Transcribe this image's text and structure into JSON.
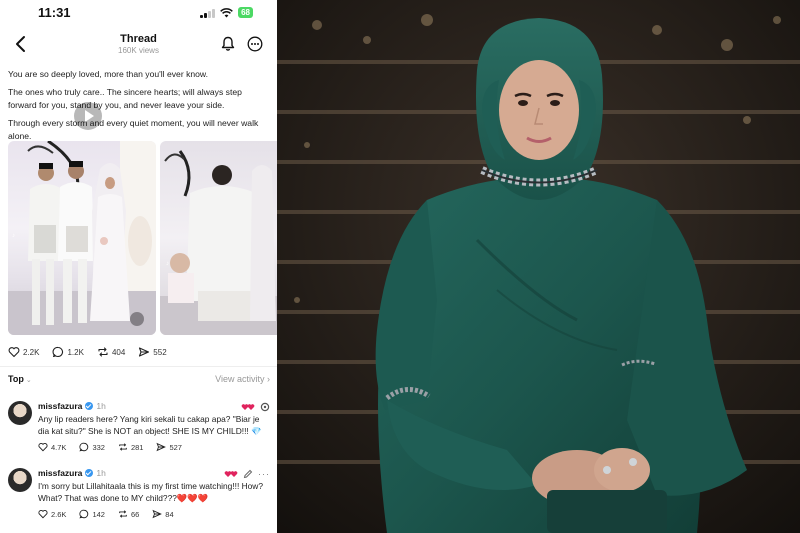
{
  "status_bar": {
    "time": "11:31",
    "battery": "68"
  },
  "thread_header": {
    "title": "Thread",
    "views": "160K views"
  },
  "post": {
    "paragraphs": [
      "You are so deeply loved, more than you'll ever know.",
      "The ones who truly care.. The sincere hearts; will always step forward for you, stand by you, and never leave your side.",
      "Through every storm and every quiet moment, you will never walk alone."
    ],
    "actions": {
      "likes": "2.2K",
      "replies": "1.2K",
      "reposts": "404",
      "shares": "552"
    }
  },
  "sort": {
    "label": "Top",
    "view_activity": "View activity"
  },
  "comments": [
    {
      "username": "missfazura",
      "time": "1h",
      "text": "Any lip readers here? Yang kiri sekali tu cakap apa? \"Biar je dia kat situ?\" She is NOT an object! SHE IS MY CHILD!!! 💎",
      "likes": "4.7K",
      "replies": "332",
      "reposts": "281",
      "shares": "527"
    },
    {
      "username": "missfazura",
      "time": "1h",
      "text": "I'm sorry but Lillahitaala this is my first time watching!!! How? What? That was done to MY child???❤️❤️❤️",
      "likes": "2.6K",
      "replies": "142",
      "reposts": "66",
      "shares": "84"
    }
  ],
  "icons": [
    "back-arrow-icon",
    "bell-icon",
    "more-icon",
    "heart-icon",
    "reply-icon",
    "repost-icon",
    "share-icon",
    "verified-icon",
    "play-icon",
    "mute-icon",
    "edit-icon",
    "threads-logo-icon"
  ],
  "colors": {
    "accent_verified": "#3897f0",
    "battery": "#4cd964",
    "dress": "#1f5a52"
  }
}
